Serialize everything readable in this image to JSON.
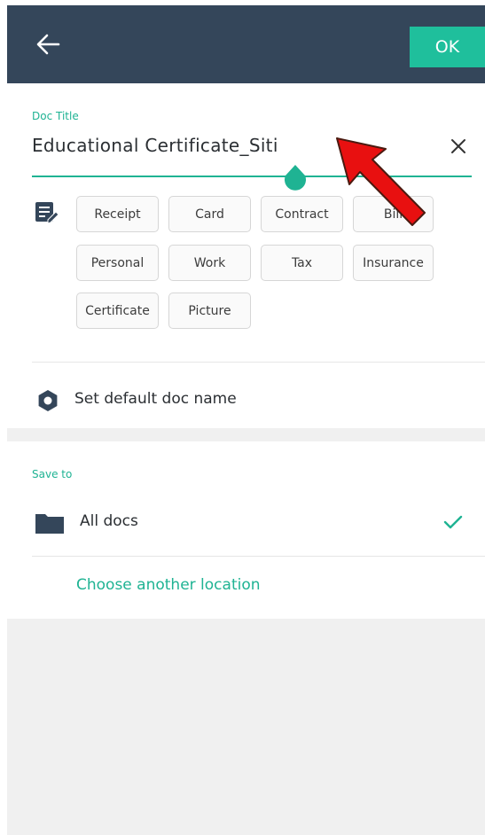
{
  "toolbar": {
    "back_icon": "arrow-left-icon",
    "ok_label": "OK"
  },
  "title_field": {
    "label": "Doc Title",
    "value": "Educational Certificate_Siti",
    "clear_icon": "close-icon"
  },
  "tags": {
    "icon": "note-edit-icon",
    "items": [
      "Receipt",
      "Card",
      "Contract",
      "Bill",
      "Personal",
      "Work",
      "Tax",
      "Insurance",
      "Certificate",
      "Picture"
    ]
  },
  "default_name": {
    "icon": "gear-icon",
    "label": "Set default doc name"
  },
  "save_to": {
    "label": "Save to",
    "location": {
      "icon": "folder-icon",
      "name": "All docs",
      "selected": true,
      "check_icon": "checkmark-icon"
    },
    "choose_label": "Choose another location"
  },
  "annotation": {
    "icon": "red-arrow-icon",
    "color": "#e81010"
  },
  "colors": {
    "topbar": "#34465a",
    "accent": "#1fbf9c",
    "background": "#f0f0f0"
  }
}
